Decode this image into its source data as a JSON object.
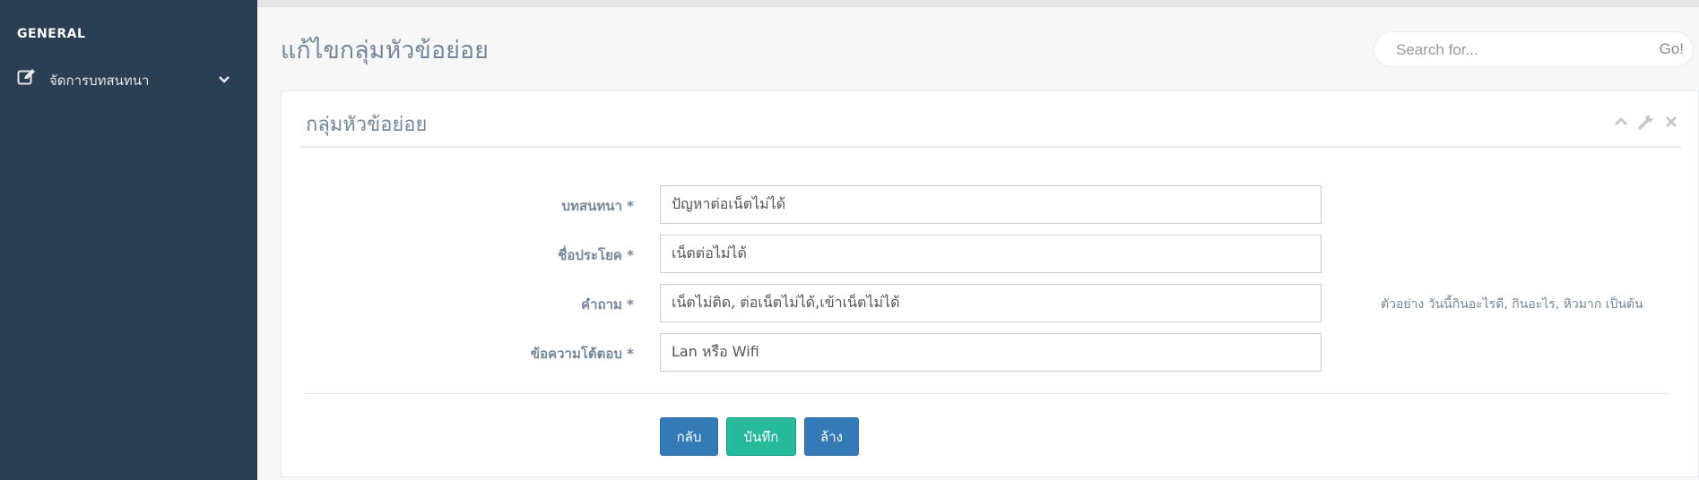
{
  "sidebar": {
    "section_title": "GENERAL",
    "menu": [
      {
        "label": "จัดการบทสนทนา",
        "icon": "edit-icon",
        "expand_icon": "chevron-down-icon"
      }
    ]
  },
  "page": {
    "title": "แก้ไขกลุ่มหัวข้อย่อย"
  },
  "search": {
    "placeholder": "Search for...",
    "button_label": "Go!"
  },
  "panel": {
    "title": "กลุ่มหัวข้อย่อย",
    "tools": [
      "chevron-up-icon",
      "wrench-icon",
      "close-icon"
    ]
  },
  "form": {
    "fields": [
      {
        "label": "บทสนทนา *",
        "value": "ปัญหาต่อเน็ตไม่ได้"
      },
      {
        "label": "ชื่อประโยค *",
        "value": "เน็ตต่อไม่ได้"
      },
      {
        "label": "คำถาม *",
        "value": "เน็ตไม่ติด, ต่อเน็ตไม่ได้,เข้าเน็ตไม่ได้",
        "hint": "ตัวอย่าง วันนี้กินอะไรดี, กินอะไร, หิวมาก เป็นต้น"
      },
      {
        "label": "ข้อความโต้ตอบ *",
        "value": "Lan หรือ Wifi"
      }
    ],
    "buttons": {
      "back": "กลับ",
      "save": "บันทึก",
      "clear": "ล้าง"
    }
  },
  "colors": {
    "sidebar_bg": "#2a3f54",
    "primary": "#337ab7",
    "success": "#26b99a"
  }
}
